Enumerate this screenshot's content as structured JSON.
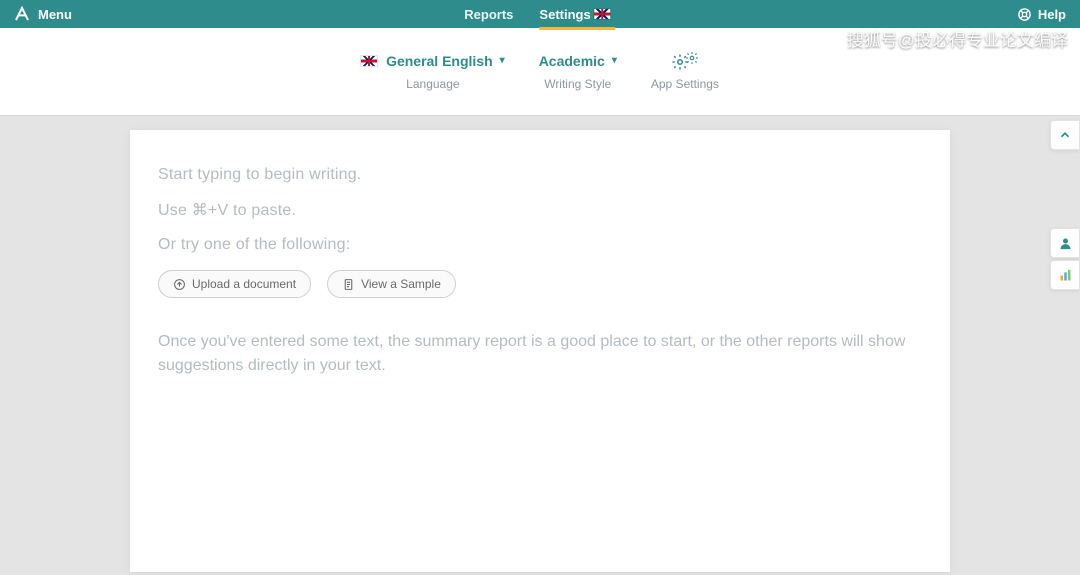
{
  "topbar": {
    "menu_label": "Menu",
    "nav": {
      "reports": "Reports",
      "settings": "Settings"
    },
    "help_label": "Help"
  },
  "subbar": {
    "language": {
      "value": "General English",
      "caption": "Language"
    },
    "style": {
      "value": "Academic",
      "caption": "Writing Style"
    },
    "appsettings": {
      "caption": "App Settings"
    }
  },
  "editor": {
    "line1": "Start typing to begin writing.",
    "line2": "Use ⌘+V to paste.",
    "line3": "Or try one of the following:",
    "upload_btn": "Upload a document",
    "sample_btn": "View a Sample",
    "desc": "Once you've entered some text, the summary report is a good place to start, or the other reports will show suggestions directly in your text."
  },
  "watermark": "搜狐号@投必得专业论文编译"
}
